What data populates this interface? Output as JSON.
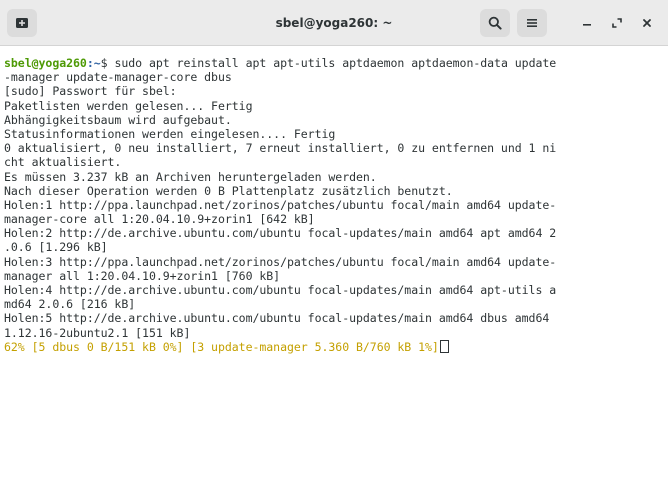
{
  "window": {
    "title": "sbel@yoga260: ~"
  },
  "headerbar": {
    "icons": {
      "new_tab": "new-tab-icon",
      "search": "search-icon",
      "menu": "hamburger-menu-icon",
      "minimize": "minimize-icon",
      "maximize": "maximize-icon",
      "close": "close-icon"
    }
  },
  "terminal": {
    "prompt": {
      "user_host": "sbel@yoga260",
      "path": ":~",
      "symbol": "$ ",
      "command": "sudo apt reinstall apt apt-utils aptdaemon aptdaemon-data update"
    },
    "lines": [
      "-manager update-manager-core dbus",
      "[sudo] Passwort für sbel:",
      "Paketlisten werden gelesen... Fertig",
      "Abhängigkeitsbaum wird aufgebaut.",
      "Statusinformationen werden eingelesen.... Fertig",
      "0 aktualisiert, 0 neu installiert, 7 erneut installiert, 0 zu entfernen und 1 ni",
      "cht aktualisiert.",
      "Es müssen 3.237 kB an Archiven heruntergeladen werden.",
      "Nach dieser Operation werden 0 B Plattenplatz zusätzlich benutzt.",
      "Holen:1 http://ppa.launchpad.net/zorinos/patches/ubuntu focal/main amd64 update-",
      "manager-core all 1:20.04.10.9+zorin1 [642 kB]",
      "Holen:2 http://de.archive.ubuntu.com/ubuntu focal-updates/main amd64 apt amd64 2",
      ".0.6 [1.296 kB]",
      "Holen:3 http://ppa.launchpad.net/zorinos/patches/ubuntu focal/main amd64 update-",
      "manager all 1:20.04.10.9+zorin1 [760 kB]",
      "Holen:4 http://de.archive.ubuntu.com/ubuntu focal-updates/main amd64 apt-utils a",
      "md64 2.0.6 [216 kB]",
      "Holen:5 http://de.archive.ubuntu.com/ubuntu focal-updates/main amd64 dbus amd64",
      "1.12.16-2ubuntu2.1 [151 kB]"
    ],
    "progress_line": "62% [5 dbus 0 B/151 kB 0%] [3 update-manager 5.360 B/760 kB 1%]"
  },
  "colors": {
    "prompt_user": "#4e9a06",
    "prompt_path": "#3465a4",
    "progress": "#c4a000",
    "text": "#2e3436",
    "background": "#ffffff"
  }
}
